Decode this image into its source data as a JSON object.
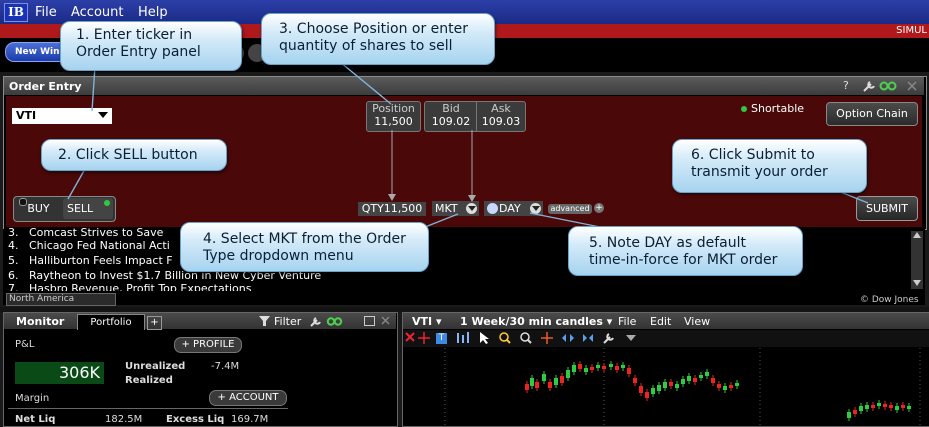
{
  "menu": {
    "logo": "IB",
    "items": [
      "File",
      "Account",
      "Help"
    ],
    "mode": "SIMUL",
    "new_window": "New Wind"
  },
  "order_entry": {
    "title": "Order Entry",
    "ticker": "VTI",
    "position_label": "Position",
    "position_value": "11,500",
    "bid_label": "Bid",
    "bid_value": "109.02",
    "ask_label": "Ask",
    "ask_value": "109.03",
    "shortable": "Shortable",
    "option_chain": "Option Chain",
    "buy": "BUY",
    "sell": "SELL",
    "side_selected": "SELL",
    "quantity": "QTY11,500",
    "order_type": "MKT",
    "tif": "DAY",
    "advanced": "advanced",
    "submit": "SUBMIT",
    "window_controls": "?",
    "colors": {
      "panel_bg": "#4a0808",
      "shortable_dot": "#31c841"
    }
  },
  "news": {
    "lines": [
      {
        "num": "3.",
        "text": "Comcast  Strives to Save"
      },
      {
        "num": "4.",
        "text": "Chicago Fed  National Acti"
      },
      {
        "num": "5.",
        "text": "Halliburton  Feels Impact F"
      },
      {
        "num": "6.",
        "text": "Raytheon  to Invest $1.7 Billion in New Cyber Venture"
      },
      {
        "num": "7.",
        "text": "Hasbro  Revenue, Profit Top Expectations"
      }
    ],
    "region": "North America",
    "source": "© Dow Jones"
  },
  "monitor": {
    "title": "Monitor",
    "tab": "Portfolio",
    "add_tab": "+",
    "filter": "Filter",
    "pnl_label": "P&L",
    "pnl_value": "306K",
    "profile_btn": "PROFILE",
    "unrealized_label": "Unrealized",
    "unrealized_value": "-7.4M",
    "realized_label": "Realized",
    "margin_label": "Margin",
    "account_btn": "ACCOUNT",
    "net_liq_label": "Net Liq",
    "net_liq_value": "182.5M",
    "excess_liq_label": "Excess Liq",
    "excess_liq_value": "169.7M"
  },
  "chart": {
    "symbol": "VTI",
    "period": "1 Week/30 min candles",
    "menus": [
      "File",
      "Edit",
      "View"
    ],
    "candle_colors": {
      "up": "#2ecc40",
      "down": "#e8251f"
    }
  },
  "callouts": {
    "c1": [
      "1. Enter ticker in",
      "Order Entry panel"
    ],
    "c2": [
      "2. Click SELL button"
    ],
    "c3": [
      "3. Choose Position or enter",
      "quantity of shares to sell"
    ],
    "c4": [
      "4. Select MKT from the Order",
      "Type dropdown menu"
    ],
    "c5": [
      "5. Note DAY as default",
      "time-in-force for MKT order"
    ],
    "c6": [
      "6. Click Submit to",
      "transmit your order"
    ]
  }
}
